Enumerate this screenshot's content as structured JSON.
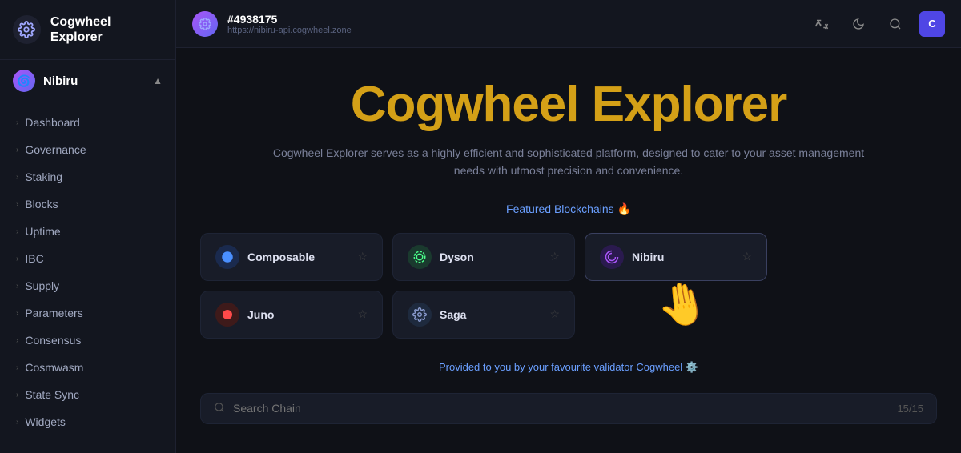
{
  "app": {
    "name": "Cogwheel Explorer",
    "logo_icon": "⚙️"
  },
  "header": {
    "node_id": "#4938175",
    "node_url": "https://nibiru-api.cogwheel.zone",
    "node_icon": "🔵",
    "icons": {
      "translate": "🌐",
      "theme": "🌙",
      "search": "🔍",
      "avatar": "C"
    }
  },
  "sidebar": {
    "chain_name": "Nibiru",
    "chain_icon": "🌀",
    "nav_items": [
      {
        "label": "Dashboard",
        "id": "dashboard"
      },
      {
        "label": "Governance",
        "id": "governance"
      },
      {
        "label": "Staking",
        "id": "staking"
      },
      {
        "label": "Blocks",
        "id": "blocks"
      },
      {
        "label": "Uptime",
        "id": "uptime"
      },
      {
        "label": "IBC",
        "id": "ibc"
      },
      {
        "label": "Supply",
        "id": "supply"
      },
      {
        "label": "Parameters",
        "id": "parameters"
      },
      {
        "label": "Consensus",
        "id": "consensus"
      },
      {
        "label": "Cosmwasm",
        "id": "cosmwasm"
      },
      {
        "label": "State Sync",
        "id": "state-sync"
      },
      {
        "label": "Widgets",
        "id": "widgets"
      }
    ]
  },
  "hero": {
    "title": "Cogwheel Explorer",
    "subtitle": "Cogwheel Explorer serves as a highly efficient and sophisticated platform, designed to cater to your asset management needs with utmost precision and convenience.",
    "featured_label": "Featured Blockchains 🔥",
    "provided_text": "Provided to you by your favourite validator Cogwheel",
    "provided_link_text": "Provided to you by your favourite validator Cogwheel"
  },
  "featured_chains": [
    {
      "name": "Composable",
      "icon": "🔵",
      "color": "#1a3a6e",
      "id": "composable"
    },
    {
      "name": "Dyson",
      "icon": "🟢",
      "color": "#1a4a2e",
      "id": "dyson"
    },
    {
      "name": "Nibiru",
      "icon": "🌀",
      "color": "#2a1a4e",
      "id": "nibiru",
      "active": true
    },
    {
      "name": "Juno",
      "icon": "🔴",
      "color": "#4e1a1a",
      "id": "juno"
    },
    {
      "name": "Saga",
      "icon": "⚙️",
      "color": "#1e2a3e",
      "id": "saga"
    }
  ],
  "search": {
    "placeholder": "Search Chain",
    "count": "15/15"
  }
}
